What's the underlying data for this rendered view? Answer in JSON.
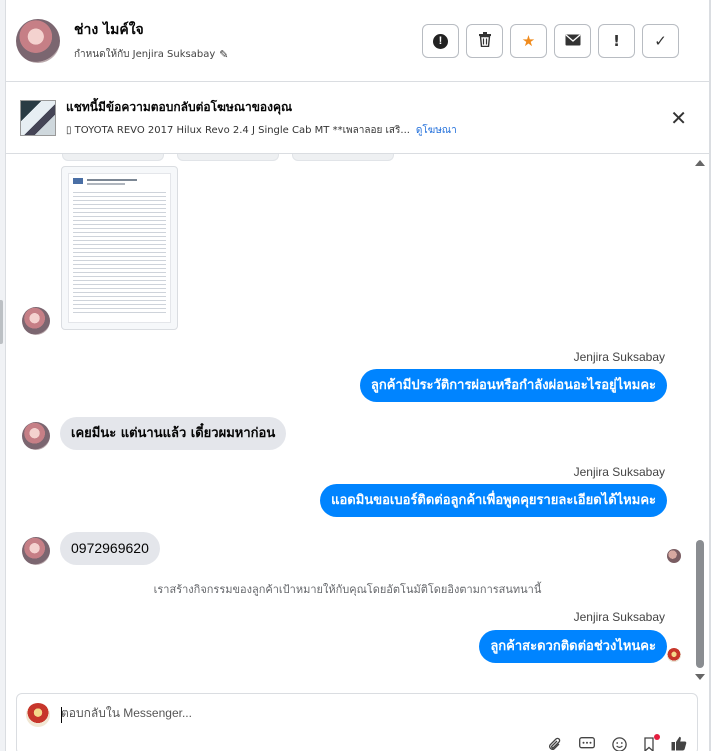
{
  "header": {
    "contact_name": "ช่าง ไมค์ใจ",
    "assigned_text": "กำหนดให้กับ Jenjira Suksabay",
    "actions": [
      {
        "name": "mark-spam",
        "icon": "!"
      },
      {
        "name": "delete",
        "icon": "🗑"
      },
      {
        "name": "star",
        "icon": "★"
      },
      {
        "name": "mark-unread",
        "icon": "✉"
      },
      {
        "name": "follow-up",
        "icon": "!"
      },
      {
        "name": "mark-done",
        "icon": "✓"
      }
    ]
  },
  "ad_banner": {
    "title": "แชทนี้มีข้อความตอบกลับต่อโฆษณาของคุณ",
    "subtitle": "▯ TOYOTA REVO 2017 Hilux Revo 2.4 J Single Cab MT **เพลาลอย เสริ...",
    "link": "ดูโฆษณา",
    "close": "✕"
  },
  "messages": {
    "out1_sender": "Jenjira Suksabay",
    "out1_text": "ลูกค้ามีประวัติการผ่อนหรือกำลังผ่อนอะไรอยู่ไหมคะ",
    "in1_text": "เคยมีนะ แต่นานแล้ว เดี๋ยวผมหาก่อน",
    "out2_sender": "Jenjira Suksabay",
    "out2_text": "แอดมินขอเบอร์ติดต่อลูกค้าเพื่อพูดคุยรายละเอียดได้ไหมคะ",
    "in2_text": "0972969620",
    "system_note": "เราสร้างกิจกรรมของลูกค้าเป้าหมายให้กับคุณโดยอัตโนมัติโดยอิงตามการสนทนานี้",
    "out3_sender": "Jenjira Suksabay",
    "out3_text": "ลูกค้าสะดวกติดต่อช่วงไหนคะ"
  },
  "composer": {
    "placeholder": "ตอบกลับใน Messenger...",
    "tools": [
      "paperclip-icon",
      "ellipsis-chat-icon",
      "emoji-icon",
      "bookmark-icon",
      "thumbs-up-icon"
    ]
  },
  "colors": {
    "outgoing_bubble": "#0084ff",
    "incoming_bubble": "#e4e6eb",
    "link": "#216fdb",
    "star": "#f08b1d"
  }
}
